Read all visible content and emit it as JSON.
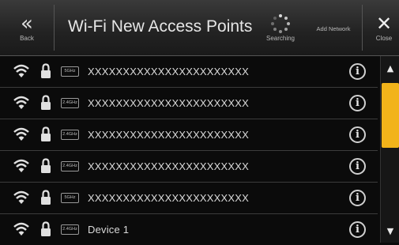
{
  "header": {
    "back_label": "Back",
    "title": "Wi-Fi New Access Points",
    "searching_label": "Searching",
    "add_network_label": "Add Network",
    "close_label": "Close"
  },
  "networks": [
    {
      "band": "5GHz",
      "ssid": "XXXXXXXXXXXXXXXXXXXXXXX",
      "secured": true,
      "icon": "wifi-icon"
    },
    {
      "band": "2.4GHz",
      "ssid": "XXXXXXXXXXXXXXXXXXXXXXX",
      "secured": true,
      "icon": "wifi-icon"
    },
    {
      "band": "2.4GHz",
      "ssid": "XXXXXXXXXXXXXXXXXXXXXXX",
      "secured": true,
      "icon": "wifi-icon"
    },
    {
      "band": "2.4GHz",
      "ssid": "XXXXXXXXXXXXXXXXXXXXXXX",
      "secured": true,
      "icon": "wifi-icon"
    },
    {
      "band": "5GHz",
      "ssid": "XXXXXXXXXXXXXXXXXXXXXXX",
      "secured": true,
      "icon": "wifi-icon"
    },
    {
      "band": "2.4GHz",
      "ssid": "Device 1",
      "secured": true,
      "icon": "wifi-icon"
    }
  ],
  "colors": {
    "accent": "#f2b31a",
    "background": "#0b0b0b",
    "header": "#2a2a2a",
    "text": "#e8e8e8"
  }
}
